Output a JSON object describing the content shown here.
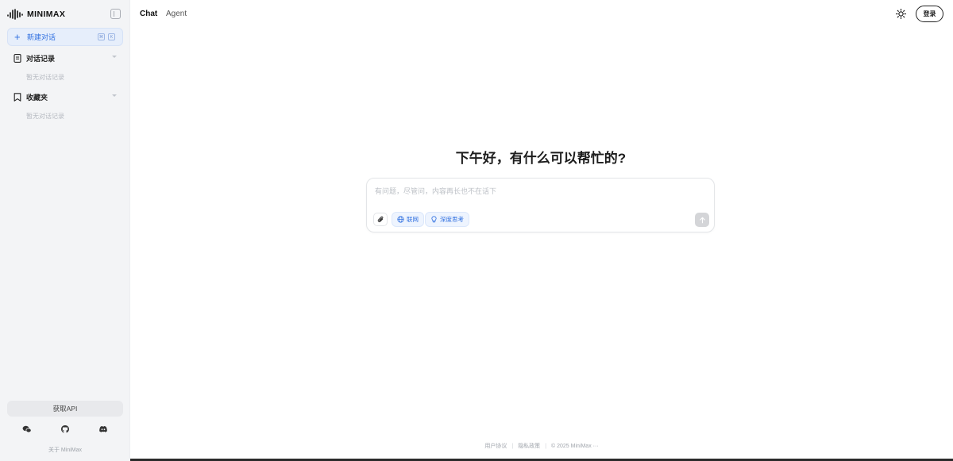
{
  "brand": {
    "name": "MINIMAX"
  },
  "sidebar": {
    "new_chat": {
      "label": "新建对话",
      "shortcut_keys": [
        "⌘",
        "K"
      ]
    },
    "sections": [
      {
        "title": "对话记录",
        "empty_text": "暂无对话记录",
        "icon": "document-icon"
      },
      {
        "title": "收藏夹",
        "empty_text": "暂无对话记录",
        "icon": "bookmark-icon"
      }
    ],
    "api_button": "获取API",
    "social_icons": [
      "wechat-icon",
      "github-icon",
      "discord-icon"
    ],
    "about": "关于 MiniMax"
  },
  "header": {
    "tabs": [
      {
        "label": "Chat",
        "active": true
      },
      {
        "label": "Agent",
        "active": false
      }
    ],
    "login_label": "登录"
  },
  "main": {
    "greeting": "下午好，有什么可以帮忙的?",
    "composer": {
      "placeholder": "有问题，尽管问，内容再长也不在话下",
      "chips": [
        {
          "label": "联网",
          "icon": "globe-icon"
        },
        {
          "label": "深度思考",
          "icon": "lightbulb-icon"
        }
      ]
    }
  },
  "footer": {
    "links": [
      "用户协议",
      "隐私政策",
      "© 2025 MiniMax ···"
    ]
  },
  "colors": {
    "accent": "#2f6fe0",
    "sidebar_bg": "#f3f4f6"
  }
}
